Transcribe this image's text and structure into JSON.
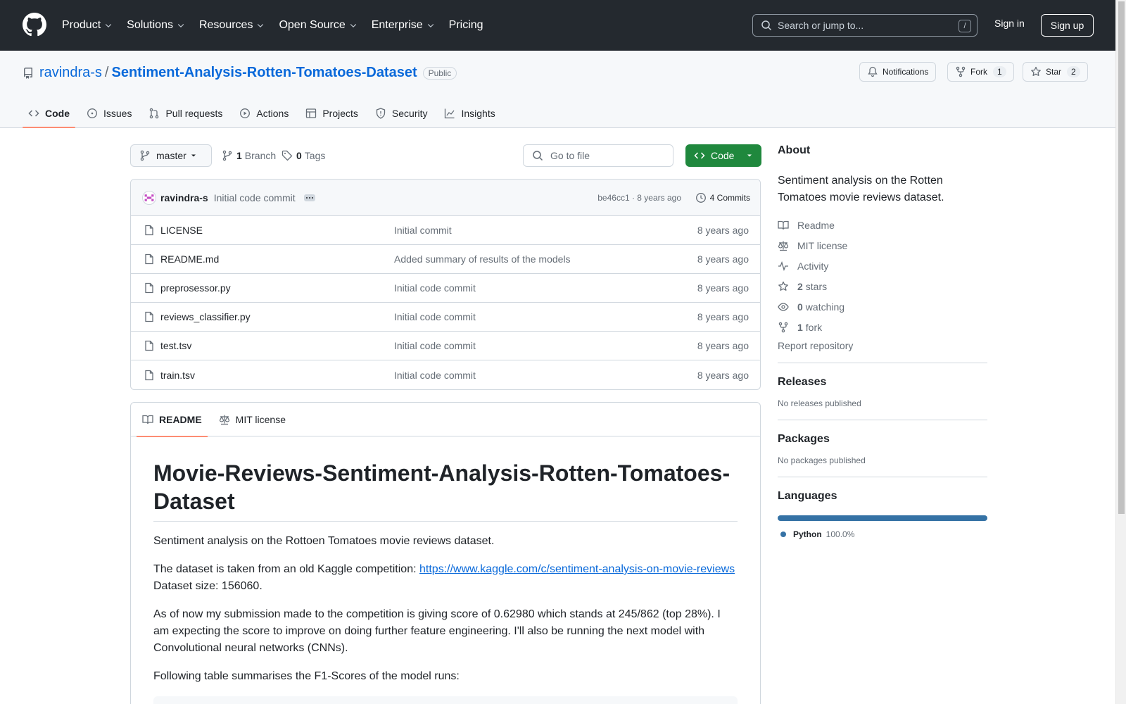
{
  "header": {
    "nav": [
      "Product",
      "Solutions",
      "Resources",
      "Open Source",
      "Enterprise",
      "Pricing"
    ],
    "search_placeholder": "Search or jump to...",
    "search_shortcut": "/",
    "signin": "Sign in",
    "signup": "Sign up"
  },
  "repo": {
    "owner": "ravindra-s",
    "separator": "/",
    "name": "Sentiment-Analysis-Rotten-Tomatoes-Dataset",
    "visibility": "Public",
    "notifications_label": "Notifications",
    "fork_label": "Fork",
    "fork_count": "1",
    "star_label": "Star",
    "star_count": "2"
  },
  "tabs": [
    "Code",
    "Issues",
    "Pull requests",
    "Actions",
    "Projects",
    "Security",
    "Insights"
  ],
  "filebar": {
    "branch": "master",
    "branch_count": "1",
    "branch_label": "Branch",
    "tag_count": "0",
    "tag_label": "Tags",
    "goto_placeholder": "Go to file",
    "code_label": "Code"
  },
  "commit": {
    "author": "ravindra-s",
    "message": "Initial code commit",
    "meta": "be46cc1 · 8 years ago",
    "commits_label": "4 Commits"
  },
  "files": [
    {
      "name": "LICENSE",
      "msg": "Initial commit",
      "age": "8 years ago"
    },
    {
      "name": "README.md",
      "msg": "Added summary of results of the models",
      "age": "8 years ago"
    },
    {
      "name": "preprosessor.py",
      "msg": "Initial code commit",
      "age": "8 years ago"
    },
    {
      "name": "reviews_classifier.py",
      "msg": "Initial code commit",
      "age": "8 years ago"
    },
    {
      "name": "test.tsv",
      "msg": "Initial code commit",
      "age": "8 years ago"
    },
    {
      "name": "train.tsv",
      "msg": "Initial code commit",
      "age": "8 years ago"
    }
  ],
  "readme": {
    "tab_readme": "README",
    "tab_license": "MIT license",
    "heading": "Movie-Reviews-Sentiment-Analysis-Rotten-Tomatoes-Dataset",
    "p1": "Sentiment analysis on the Rottoen Tomatoes movie reviews dataset.",
    "p2_prefix": "The dataset is taken from an old Kaggle competition: ",
    "p2_link": "https://www.kaggle.com/c/sentiment-analysis-on-movie-reviews",
    "p2_suffix": "Dataset size: 156060.",
    "p3": "As of now my submission made to the competition is giving score of 0.62980 which stands at 245/862 (top 28%). I am expecting the score to improve on doing further feature engineering. I'll also be running the next model with Convolutional neural networks (CNNs).",
    "p4": "Following table summarises the F1-Scores of the model runs:"
  },
  "sidebar": {
    "about_title": "About",
    "about_desc": "Sentiment analysis on the Rotten Tomatoes movie reviews dataset.",
    "readme": "Readme",
    "license": "MIT license",
    "activity": "Activity",
    "stars_count": "2",
    "stars_label": "stars",
    "watching_count": "0",
    "watching_label": "watching",
    "fork_count": "1",
    "fork_label": "fork",
    "report": "Report repository",
    "releases_title": "Releases",
    "releases_text": "No releases published",
    "packages_title": "Packages",
    "packages_text": "No packages published",
    "languages_title": "Languages",
    "language_name": "Python",
    "language_pct": "100.0%",
    "language_share": 1.0,
    "language_color": "#3572A5"
  },
  "colors": {
    "header_bg": "#24292f",
    "link": "#0969da",
    "code_button": "#1f883d",
    "active_tab_underline": "#fd8c73"
  }
}
